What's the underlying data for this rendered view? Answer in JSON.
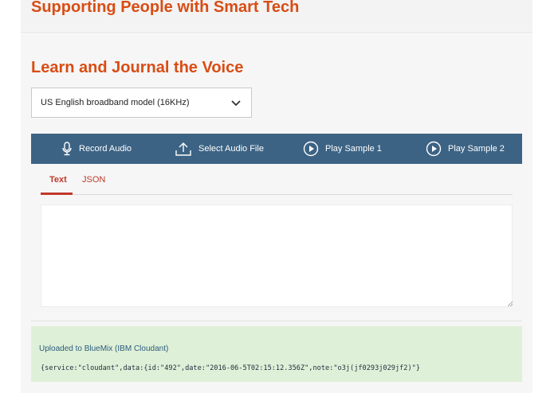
{
  "header": {
    "title": "Supporting People with Smart Tech"
  },
  "section": {
    "title": "Learn and Journal the Voice"
  },
  "model_select": {
    "selected": "US English broadband model (16KHz)",
    "icon": "chevron-down-icon"
  },
  "toolbar": {
    "record_label": "Record Audio",
    "record_icon": "microphone-icon",
    "select_file_label": "Select Audio File",
    "select_file_icon": "upload-icon",
    "sample1_label": "Play Sample 1",
    "sample2_label": "Play Sample 2",
    "play_icon": "play-circle-icon",
    "background_color": "#3c6384"
  },
  "tabs": [
    {
      "label": "Text",
      "active": true
    },
    {
      "label": "JSON",
      "active": false
    }
  ],
  "transcript": {
    "value": ""
  },
  "status": {
    "label": "Uploaded to BlueMix (IBM Cloudant)",
    "json": "{service:\"cloudant\",data:{id:\"492\",date:\"2016-06-5T02:15:12.356Z\",note:\"o3j(jf0293j029jf2)\"}",
    "background_color": "#dff0d8"
  },
  "colors": {
    "accent": "#d84d14",
    "tab_active": "#c0392b"
  }
}
